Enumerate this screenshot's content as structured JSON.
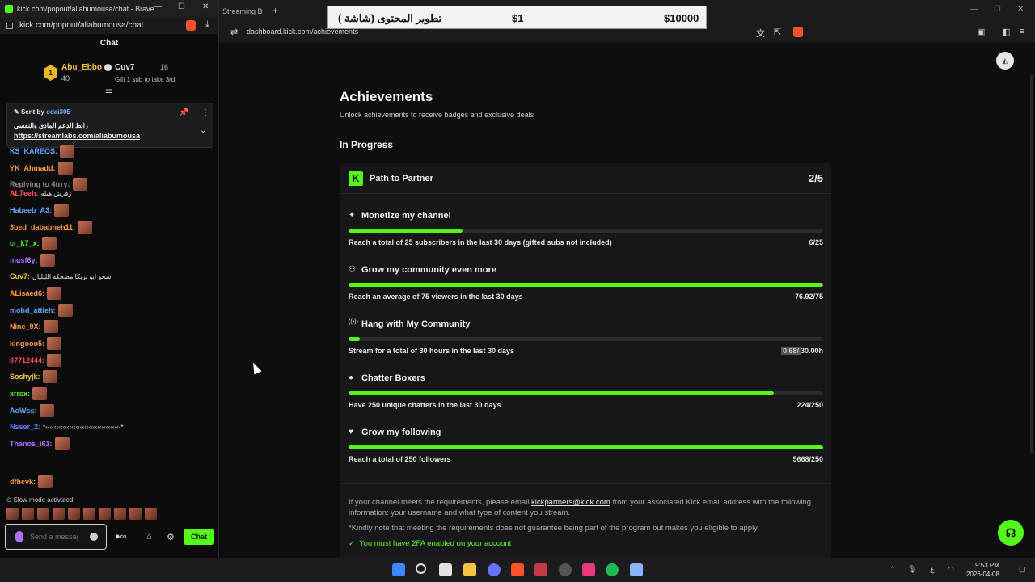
{
  "chat_window": {
    "title": "kick.com/popout/aliabumousa/chat - Brave",
    "url": "kick.com/popout/aliabumousa/chat",
    "header": "Chat",
    "leaderboard": {
      "rank1_place": "1",
      "rank1_name": "Abu_Ebbo",
      "rank1_count": "40",
      "rank2_name": "Cuv7",
      "rank2_count": "16",
      "rank2_hint": "Gift 1 sub to take 3rd"
    },
    "pinned": {
      "sent_by_label": "Sent by",
      "sent_by_user": "odai305",
      "text": "رابط الدعم المادي والنفسي",
      "link": "https://streamlabs.com/aliabumousa"
    },
    "messages": [
      {
        "user": "KS_KAREOS:",
        "color": "#5aa9ff",
        "text": ""
      },
      {
        "user": "YK_Ahmadd:",
        "color": "#ff9a3d",
        "text": ""
      },
      {
        "user": "Replying to 4trry:",
        "color": "#8a8a8a",
        "text": ""
      },
      {
        "user": "AL7eeh:",
        "color": "#ff5a5a",
        "text": "زفرش هيله"
      },
      {
        "user": "Habeeb_A3:",
        "color": "#5aa9ff",
        "text": ""
      },
      {
        "user": "3bed_dababneh11:",
        "color": "#ff9a3d",
        "text": ""
      },
      {
        "user": "cr_k7_x:",
        "color": "#53fc18",
        "text": ""
      },
      {
        "user": "musf6y:",
        "color": "#b06fff",
        "text": ""
      },
      {
        "user": "Cuv7:",
        "color": "#f5d33a",
        "text": "سحو ابو تريكا مضحكه الليليال"
      },
      {
        "user": "ALisaed6:",
        "color": "#ff9a3d",
        "text": ""
      },
      {
        "user": "mohd_attieh:",
        "color": "#5aa9ff",
        "text": ""
      },
      {
        "user": "Nine_9X:",
        "color": "#ff9a3d",
        "text": ""
      },
      {
        "user": "kingooo5:",
        "color": "#ff9a3d",
        "text": ""
      },
      {
        "user": "07712444:",
        "color": "#ff4d6a",
        "text": ""
      },
      {
        "user": "Soshyjk:",
        "color": "#f5d33a",
        "text": ""
      },
      {
        "user": "xrrex:",
        "color": "#53fc18",
        "text": ""
      },
      {
        "user": "AoWss:",
        "color": "#5aa9ff",
        "text": ""
      },
      {
        "user": "Nsser_2:",
        "color": "#5a7cff",
        "text": "*‹‹‹‹‹‹‹‹‹‹‹‹‹‹‹‹‹‹‹‹‹‹‹‹‹‹‹‹‹‹‹‹‹‹‹*"
      },
      {
        "user": "Thanos_i61:",
        "color": "#b06fff",
        "text": ""
      },
      {
        "user": "dfhcvk:",
        "color": "#ff9a3d",
        "text": ""
      }
    ],
    "slow_mode": "Slow mode activated",
    "input_placeholder": "Send a message",
    "send_label": "Chat"
  },
  "browser": {
    "partial_tab": "Streaming B",
    "url": "dashboard.kick.com/achievements"
  },
  "donation_overlay": {
    "title": "تطوير المحتوى (شاشة )",
    "amount": "$1",
    "goal": "$10000"
  },
  "page": {
    "title": "Achievements",
    "subtitle": "Unlock achievements to receive badges and exclusive deals",
    "section": "In Progress",
    "card_title": "Path to Partner",
    "card_count": "2/5",
    "goals": [
      {
        "icon": "✦",
        "title": "Monetize my channel",
        "desc": "Reach a total of 25 subscribers in the last 30 days (gifted subs not included)",
        "value": "6/25",
        "progress": 0.24
      },
      {
        "icon": "⚇",
        "title": "Grow my community even more",
        "desc": "Reach an average of 75 viewers in the last 30 days",
        "value": "76.92/75",
        "progress": 1.0
      },
      {
        "icon": "((•))",
        "title": "Hang with My Community",
        "desc": "Stream for a total of 30 hours in the last 30 days",
        "value_hl": "0.68/",
        "value": "30.00h",
        "progress": 0.023
      },
      {
        "icon": "●",
        "title": "Chatter Boxers",
        "desc": "Have 250 unique chatters in the last 30 days",
        "value": "224/250",
        "progress": 0.896
      },
      {
        "icon": "♥",
        "title": "Grow my following",
        "desc": "Reach a total of 250 followers",
        "value": "5668/250",
        "progress": 1.0
      }
    ],
    "footer_pre": "If your channel meets the requirements, please email",
    "footer_email": "kickpartners@kick.com",
    "footer_post": "from your associated Kick email address with the following information: your username and what type of content you stream.",
    "footer_note": "*Kindly note that meeting the requirements does not guarantee being part of the program but makes you eligible to apply.",
    "footer_check": "You must have 2FA enabled on your account",
    "accent": "#53fc18"
  },
  "taskbar": {
    "time": "9:53 PM",
    "date": "2026-04-08"
  }
}
